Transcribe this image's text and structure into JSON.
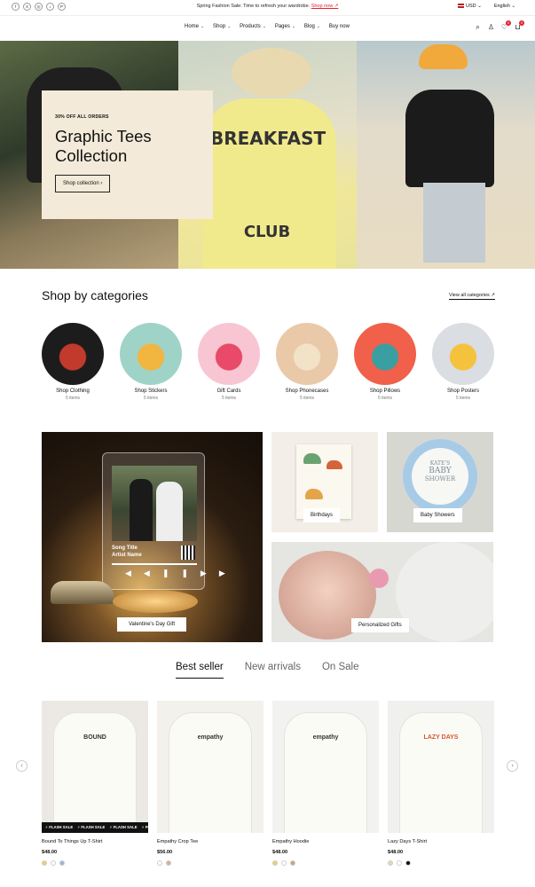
{
  "topbar": {
    "socials": [
      {
        "icon": "facebook-icon",
        "glyph": "f"
      },
      {
        "icon": "x-icon",
        "glyph": "X"
      },
      {
        "icon": "instagram-icon",
        "glyph": "◎"
      },
      {
        "icon": "tiktok-icon",
        "glyph": "♪"
      },
      {
        "icon": "pinterest-icon",
        "glyph": "P"
      }
    ],
    "announcement": "Spring Fashion Sale: Time to refresh your wardrobe.",
    "announcement_link": "Shop now ↗",
    "currency": "USD",
    "language": "English"
  },
  "nav": {
    "items": [
      {
        "label": "Home",
        "has_caret": true
      },
      {
        "label": "Shop",
        "has_caret": true
      },
      {
        "label": "Products",
        "has_caret": true
      },
      {
        "label": "Pages",
        "has_caret": true
      },
      {
        "label": "Blog",
        "has_caret": true
      },
      {
        "label": "Buy now",
        "has_caret": false
      }
    ],
    "wishlist_count": "0",
    "cart_count": "0"
  },
  "hero": {
    "eyebrow": "30% OFF ALL ORDERS",
    "title_line1": "Graphic Tees",
    "title_line2": "Collection",
    "button": "Shop collection ›",
    "panel2_text1": "BREAKFAST",
    "panel2_text2": "CLUB"
  },
  "categories": {
    "heading": "Shop by categories",
    "view_all": "View all categories ↗",
    "items": [
      {
        "name": "Shop Clothing",
        "count": "5 items",
        "bg": "#1c1c1c",
        "accent": "#c23a2c"
      },
      {
        "name": "Shop Stickers",
        "count": "5 items",
        "bg": "#9fd3c8",
        "accent": "#f2b540"
      },
      {
        "name": "Gift Cards",
        "count": "5 items",
        "bg": "#f7c6d2",
        "accent": "#e84a67"
      },
      {
        "name": "Shop Phonecases",
        "count": "5 items",
        "bg": "#e9c9a8",
        "accent": "#f2e3c8"
      },
      {
        "name": "Shop Pillows",
        "count": "5 items",
        "bg": "#f0604a",
        "accent": "#3a9fa0"
      },
      {
        "name": "Shop Posters",
        "count": "5 items",
        "bg": "#dadde2",
        "accent": "#f4c23c"
      }
    ]
  },
  "promos": {
    "valentine": "Valentine's Day Gift",
    "birthdays": "Birthdays",
    "baby_showers": "Baby Showers",
    "personalized": "Personalized Gifts",
    "song_title": "Song Title",
    "artist_name": "Artist Name",
    "baby_plate_line1": "KATE'S",
    "baby_plate_line2": "BABY",
    "baby_plate_line3": "SHOWER"
  },
  "tabs": [
    {
      "label": "Best seller",
      "active": true
    },
    {
      "label": "New arrivals",
      "active": false
    },
    {
      "label": "On Sale",
      "active": false
    }
  ],
  "products": [
    {
      "name": "Bound To Things Up T-Shirt",
      "price": "$48.00",
      "flash": true,
      "art": "BOUND",
      "swatches": [
        "#e6d36a",
        "#ffffff",
        "#9db3d9"
      ],
      "bg": "#ece9e4"
    },
    {
      "name": "Empathy Crop Tee",
      "price": "$56.00",
      "flash": false,
      "art": "empathy",
      "swatches": [
        "#ffffff",
        "#d4b48a"
      ],
      "bg": "#f3f1ec"
    },
    {
      "name": "Empathy Hoodie",
      "price": "$48.00",
      "flash": false,
      "art": "empathy",
      "swatches": [
        "#e6d36a",
        "#ffffff",
        "#c8a86e"
      ],
      "bg": "#f2f2f0"
    },
    {
      "name": "Lazy Days T-Shirt",
      "price": "$48.00",
      "flash": false,
      "art": "LAZY DAYS",
      "swatches": [
        "#e8dca0",
        "#ffffff",
        "#111111"
      ],
      "bg": "#f0f0ee"
    }
  ],
  "flash_label": "⚡ FLASH SALE"
}
